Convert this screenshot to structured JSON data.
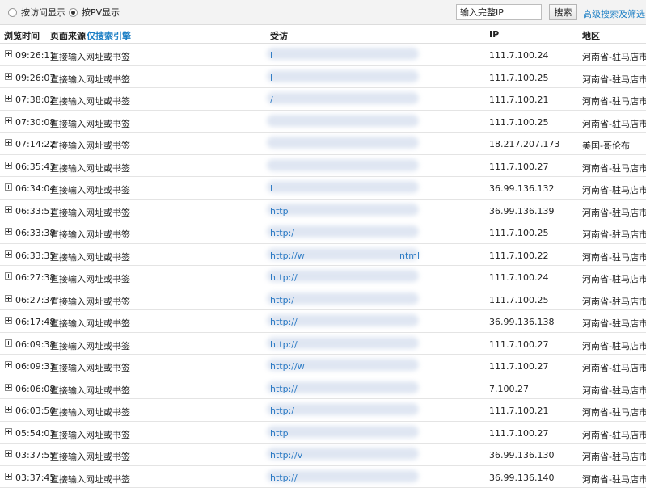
{
  "filters": {
    "by_visit": "按访问显示",
    "by_pv": "按PV显示",
    "selected": "by_pv"
  },
  "search": {
    "input_value": "输入完整IP",
    "button": "搜索",
    "advanced": "高级搜索及筛选"
  },
  "columns": {
    "time": "浏览时间",
    "source": "页面来源",
    "search_only": "仅搜索引擎",
    "visited": "受访",
    "ip": "IP",
    "region": "地区"
  },
  "rows": [
    {
      "time": "09:26:11",
      "source": "直接输入网址或书签",
      "url": "l",
      "ip": "111.7.100.24",
      "region": "河南省-驻马店市"
    },
    {
      "time": "09:26:07",
      "source": "直接输入网址或书签",
      "url": "l",
      "ip": "111.7.100.25",
      "region": "河南省-驻马店市"
    },
    {
      "time": "07:38:02",
      "source": "直接输入网址或书签",
      "url": "/",
      "ip": "111.7.100.21",
      "region": "河南省-驻马店市"
    },
    {
      "time": "07:30:08",
      "source": "直接输入网址或书签",
      "url": "",
      "ip": "111.7.100.25",
      "region": "河南省-驻马店市"
    },
    {
      "time": "07:14:22",
      "source": "直接输入网址或书签",
      "url": "",
      "ip": "18.217.207.173",
      "region": "美国-哥伦布"
    },
    {
      "time": "06:35:43",
      "source": "直接输入网址或书签",
      "url": "",
      "ip": "111.7.100.27",
      "region": "河南省-驻马店市"
    },
    {
      "time": "06:34:04",
      "source": "直接输入网址或书签",
      "url": "l",
      "ip": "36.99.136.132",
      "region": "河南省-驻马店市"
    },
    {
      "time": "06:33:51",
      "source": "直接输入网址或书签",
      "url": "http",
      "ip": "36.99.136.139",
      "region": "河南省-驻马店市"
    },
    {
      "time": "06:33:38",
      "source": "直接输入网址或书签",
      "url": "http:/",
      "ip": "111.7.100.25",
      "region": "河南省-驻马店市"
    },
    {
      "time": "06:33:35",
      "source": "直接输入网址或书签",
      "url": "http://w",
      "url_tail": "ntml",
      "ip": "111.7.100.22",
      "region": "河南省-驻马店市"
    },
    {
      "time": "06:27:38",
      "source": "直接输入网址或书签",
      "url": "http://",
      "ip": "111.7.100.24",
      "region": "河南省-驻马店市"
    },
    {
      "time": "06:27:34",
      "source": "直接输入网址或书签",
      "url": "http:/",
      "ip": "111.7.100.25",
      "region": "河南省-驻马店市"
    },
    {
      "time": "06:17:48",
      "source": "直接输入网址或书签",
      "url": "http://",
      "ip": "36.99.136.138",
      "region": "河南省-驻马店市"
    },
    {
      "time": "06:09:38",
      "source": "直接输入网址或书签",
      "url": "http://",
      "ip": "111.7.100.27",
      "region": "河南省-驻马店市"
    },
    {
      "time": "06:09:33",
      "source": "直接输入网址或书签",
      "url": "http://w",
      "ip": "111.7.100.27",
      "region": "河南省-驻马店市"
    },
    {
      "time": "06:06:08",
      "source": "直接输入网址或书签",
      "url": "http://",
      "ip": "7.100.27",
      "region": "河南省-驻马店市"
    },
    {
      "time": "06:03:50",
      "source": "直接输入网址或书签",
      "url": "http:/",
      "ip": "111.7.100.21",
      "region": "河南省-驻马店市"
    },
    {
      "time": "05:54:03",
      "source": "直接输入网址或书签",
      "url": "http",
      "ip": "111.7.100.27",
      "region": "河南省-驻马店市"
    },
    {
      "time": "03:37:55",
      "source": "直接输入网址或书签",
      "url": "http://v",
      "ip": "36.99.136.130",
      "region": "河南省-驻马店市"
    },
    {
      "time": "03:37:45",
      "source": "直接输入网址或书签",
      "url": "http://",
      "ip": "36.99.136.140",
      "region": "河南省-驻马店市"
    }
  ]
}
